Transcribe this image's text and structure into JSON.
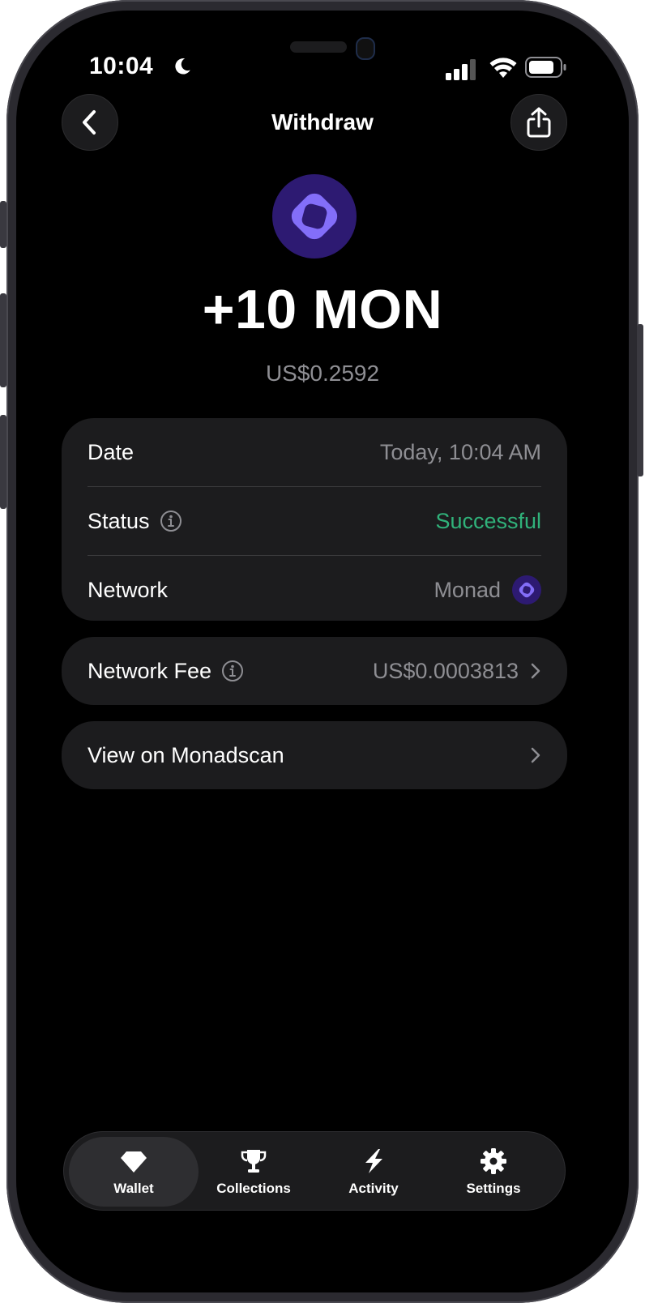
{
  "status_bar": {
    "time": "10:04"
  },
  "header": {
    "title": "Withdraw"
  },
  "transaction": {
    "amount": "+10 MON",
    "fiat_value": "US$0.2592"
  },
  "details": {
    "date_label": "Date",
    "date_value": "Today, 10:04 AM",
    "status_label": "Status",
    "status_value": "Successful",
    "network_label": "Network",
    "network_value": "Monad"
  },
  "fee": {
    "label": "Network Fee",
    "value": "US$0.0003813"
  },
  "explorer": {
    "label": "View on Monadscan"
  },
  "tabs": [
    {
      "label": "Wallet",
      "icon": "diamond-icon",
      "active": true
    },
    {
      "label": "Collections",
      "icon": "trophy-icon",
      "active": false
    },
    {
      "label": "Activity",
      "icon": "lightning-icon",
      "active": false
    },
    {
      "label": "Settings",
      "icon": "gear-icon",
      "active": false
    }
  ],
  "colors": {
    "success": "#30b27a",
    "monad_purple": "#836ef9",
    "card_bg": "#1c1c1e"
  }
}
